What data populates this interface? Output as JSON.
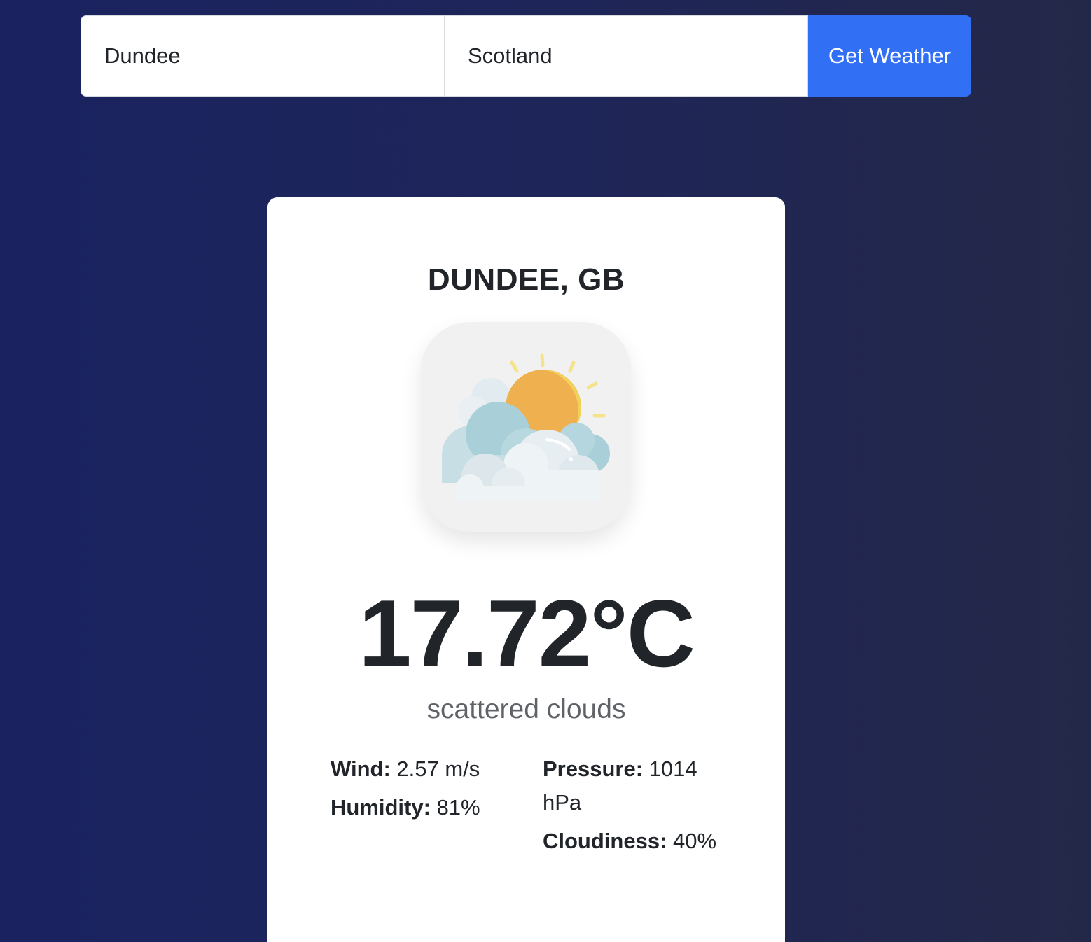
{
  "search": {
    "city_value": "Dundee",
    "country_value": "Scotland",
    "button_label": "Get Weather"
  },
  "weather": {
    "location": "DUNDEE, GB",
    "icon": "sun-behind-clouds-icon",
    "temperature": "17.72°C",
    "description": "scattered clouds",
    "wind_label": "Wind:",
    "wind_value": "2.57 m/s",
    "humidity_label": "Humidity:",
    "humidity_value": "81%",
    "pressure_label": "Pressure:",
    "pressure_value": "1014 hPa",
    "cloudiness_label": "Cloudiness:",
    "cloudiness_value": "40%"
  },
  "colors": {
    "background": "#1a2360",
    "accent": "#316ff5",
    "card": "#ffffff",
    "text": "#212529"
  }
}
